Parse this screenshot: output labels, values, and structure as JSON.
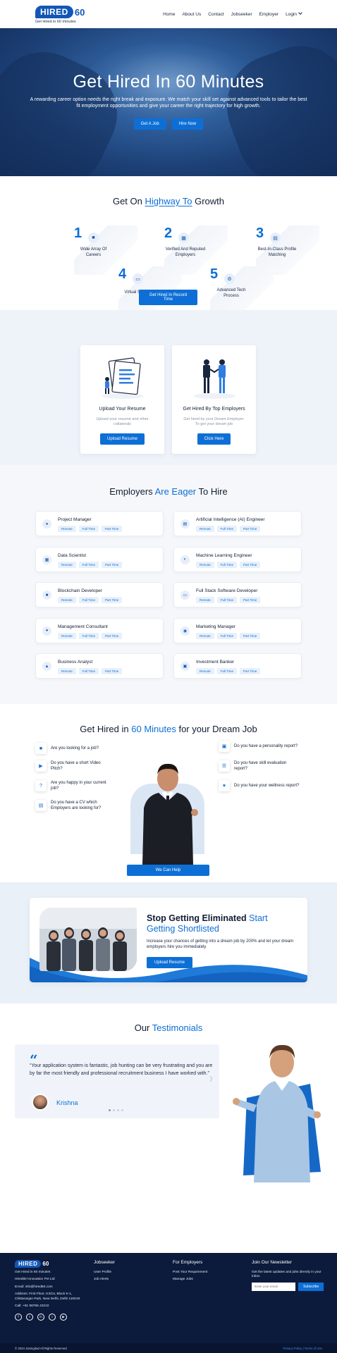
{
  "brand": {
    "name": "HIRED",
    "number": "60",
    "tagline": "Get Hired in 60 minutes"
  },
  "nav": {
    "items": [
      "Home",
      "About Us",
      "Contact",
      "Jobseeker",
      "Employer"
    ],
    "login": "Login"
  },
  "hero": {
    "title": "Get Hired In 60 Minutes",
    "subtitle": "A rewarding career option needs the right break and exposure. We match your skill set against advanced tools to tailor the best fit employment opportunities and give your career the right trajectory for high growth.",
    "btn_job": "Get A Job",
    "btn_hire": "Hire Now"
  },
  "highway": {
    "title_pre": "Get On",
    "title_hl": "Highway To",
    "title_post": "Growth",
    "steps": [
      {
        "num": "1",
        "label": "Wide Array Of Careers",
        "icon": "briefcase-icon"
      },
      {
        "num": "2",
        "label": "Verified And Reputed Employers",
        "icon": "building-icon"
      },
      {
        "num": "3",
        "label": "Best-In-Class Profile Matching",
        "icon": "id-card-icon"
      },
      {
        "num": "4",
        "label": "Virtual Selection",
        "icon": "monitor-icon"
      },
      {
        "num": "5",
        "label": "Advanced Tech Process",
        "icon": "gear-icon"
      }
    ],
    "button": "Get Hired In Record Time"
  },
  "upload": {
    "resume": {
      "title": "Upload Your Resume",
      "desc": "Upload your resume and other collaterals",
      "btn": "Upload Resume"
    },
    "employers": {
      "title": "Get Hired By Top Employers",
      "desc": "Get hired by your Dream Employer. To get your dream job",
      "btn": "Click Here"
    }
  },
  "employers": {
    "title_pre": "Employers",
    "title_hl": "Are Eager",
    "title_post": "To Hire",
    "tags": [
      "Remote",
      "Full Time",
      "Part Time"
    ],
    "jobs": [
      {
        "title": "Project Manager",
        "icon": "user-icon"
      },
      {
        "title": "Artificial Intelligence (AI) Engineer",
        "icon": "server-icon"
      },
      {
        "title": "Data Scientist",
        "icon": "calendar-icon"
      },
      {
        "title": "Machine Learning Engineer",
        "icon": "pie-chart-icon"
      },
      {
        "title": "Blockchain Developer",
        "icon": "lock-icon"
      },
      {
        "title": "Full Stack Software Developer",
        "icon": "desktop-icon"
      },
      {
        "title": "Management Consultant",
        "icon": "drop-icon"
      },
      {
        "title": "Marketing Manager",
        "icon": "eye-icon"
      },
      {
        "title": "Business Analyst",
        "icon": "chart-icon"
      },
      {
        "title": "Investment Banker",
        "icon": "money-icon"
      }
    ]
  },
  "dream": {
    "title_pre": "Get Hired in",
    "title_hl": "60 Minutes",
    "title_post": "for your Dream Job",
    "left": [
      {
        "text": "Are you looking for a job?",
        "icon": "briefcase-icon"
      },
      {
        "text": "Do you have a short Video Pitch?",
        "icon": "video-icon"
      },
      {
        "text": "Are you happy in your current job?",
        "icon": "question-icon"
      },
      {
        "text": "Do you have a CV which Employers are looking for?",
        "icon": "cv-icon"
      }
    ],
    "right": [
      {
        "text": "Do you have a personality report?",
        "icon": "file-icon"
      },
      {
        "text": "Do you have skill evaluation report?",
        "icon": "list-icon"
      },
      {
        "text": "Do you have your wellness report?",
        "icon": "wellness-icon"
      }
    ],
    "button": "We Can Help"
  },
  "stop": {
    "title_1": "Stop Getting Eliminated",
    "title_hl": "Start Getting",
    "title_2": "Shortlisted",
    "desc": "Increase your chances of getting into a dream job by 200% and let your dream employers hire you immediately",
    "button": "Upload Resume"
  },
  "testimonials": {
    "title_pre": "Our",
    "title_hl": "Testimonials",
    "quote": "“Your application system is fantastic, job hunting can be very frustrating and you are by far the most friendly and professional recruitment business I have worked with.”",
    "name": "Krishna"
  },
  "footer": {
    "tagline": "Get Hired in 60 minutes",
    "company": "Hired60 Innovation Pvt Ltd",
    "email": "Email: info@hired60.com",
    "address": "Address: First Floor, K3/14, Block K-1, Chittaranjan Park, New Delhi, Delhi 110019",
    "phone": "Call: +91 98765 43210",
    "jobseeker_title": "Jobseeker",
    "jobseeker_links": [
      "User Profile",
      "Job Alerts"
    ],
    "employers_title": "For Employers",
    "employers_links": [
      "Post Your Requirement",
      "Manage Jobs"
    ],
    "newsletter_title": "Join Our Newsletter",
    "newsletter_desc": "Get the latest updates and jobs directly in your inbox",
    "newsletter_placeholder": "Enter your email",
    "newsletter_btn": "Subscribe",
    "copyright": "© 2024 Jasmgdad All Rights Reserved",
    "privacy": "Privacy Policy | Terms of Use"
  },
  "colors": {
    "primary": "#0d6fd6",
    "dark": "#0c1b3c",
    "heroBlue": "#1c3f75"
  }
}
